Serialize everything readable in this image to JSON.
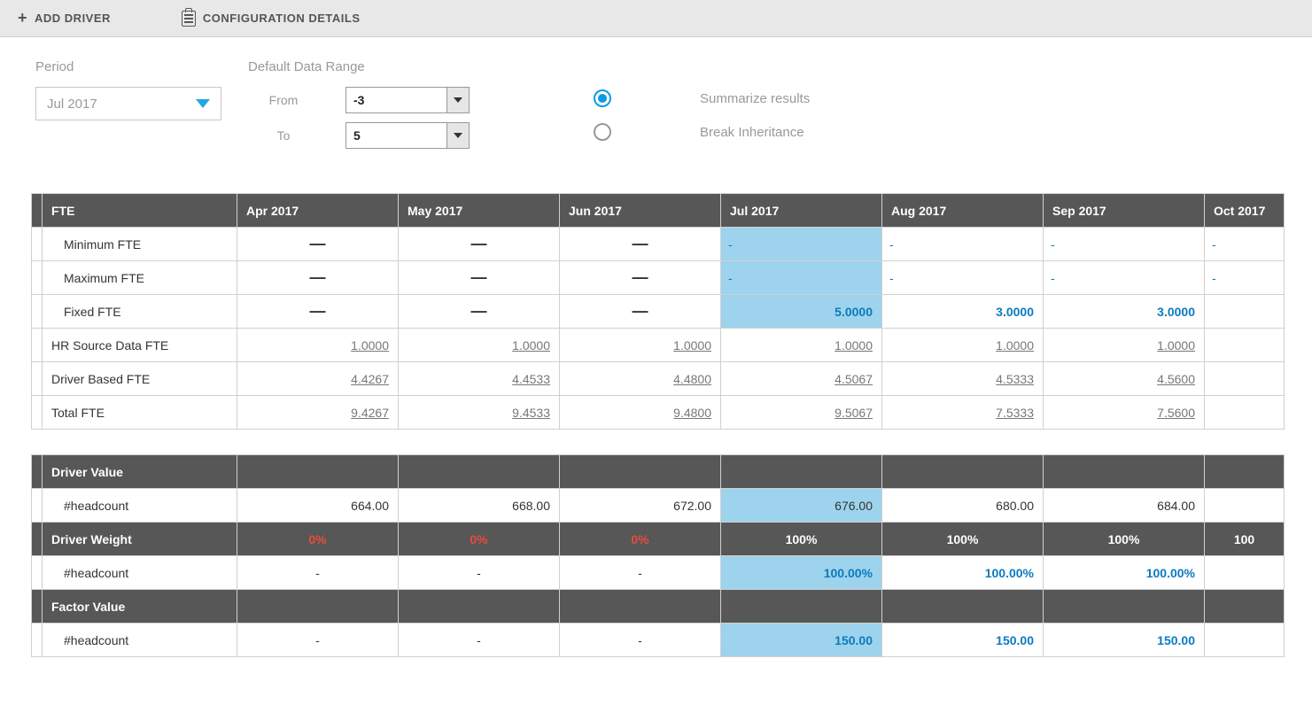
{
  "toolbar": {
    "add_driver": "ADD DRIVER",
    "config_details": "CONFIGURATION DETAILS"
  },
  "controls": {
    "period_label": "Period",
    "period_value": "Jul 2017",
    "range_label": "Default Data Range",
    "from_label": "From",
    "from_value": "-3",
    "to_label": "To",
    "to_value": "5",
    "radio_summarize": "Summarize results",
    "radio_break": "Break Inheritance"
  },
  "months": [
    "Apr 2017",
    "May 2017",
    "Jun 2017",
    "Jul 2017",
    "Aug 2017",
    "Sep 2017",
    "Oct 2017"
  ],
  "fte": {
    "title": "FTE",
    "rows": [
      {
        "label": "Minimum FTE",
        "indent": true,
        "cells": [
          {
            "t": "—",
            "cls": "dash"
          },
          {
            "t": "—",
            "cls": "dash"
          },
          {
            "t": "—",
            "cls": "dash"
          },
          {
            "t": "-",
            "cls": "hl hl-blue-dash"
          },
          {
            "t": "-",
            "cls": "future-dash"
          },
          {
            "t": "-",
            "cls": "future-dash"
          },
          {
            "t": "-",
            "cls": "future-dash"
          }
        ]
      },
      {
        "label": "Maximum FTE",
        "indent": true,
        "cells": [
          {
            "t": "—",
            "cls": "dash"
          },
          {
            "t": "—",
            "cls": "dash"
          },
          {
            "t": "—",
            "cls": "dash"
          },
          {
            "t": "-",
            "cls": "hl hl-blue-dash"
          },
          {
            "t": "-",
            "cls": "future-dash"
          },
          {
            "t": "-",
            "cls": "future-dash"
          },
          {
            "t": "-",
            "cls": "future-dash"
          }
        ]
      },
      {
        "label": "Fixed FTE",
        "indent": true,
        "cells": [
          {
            "t": "—",
            "cls": "dash"
          },
          {
            "t": "—",
            "cls": "dash"
          },
          {
            "t": "—",
            "cls": "dash"
          },
          {
            "t": "5.0000",
            "cls": "hl val blue-bold"
          },
          {
            "t": "3.0000",
            "cls": "val blue-bold"
          },
          {
            "t": "3.0000",
            "cls": "val blue-bold"
          },
          {
            "t": "",
            "cls": "val"
          }
        ]
      },
      {
        "label": "HR Source Data FTE",
        "indent": false,
        "cells": [
          {
            "t": "1.0000",
            "cls": "val underline"
          },
          {
            "t": "1.0000",
            "cls": "val underline"
          },
          {
            "t": "1.0000",
            "cls": "val underline"
          },
          {
            "t": "1.0000",
            "cls": "val underline"
          },
          {
            "t": "1.0000",
            "cls": "val underline"
          },
          {
            "t": "1.0000",
            "cls": "val underline"
          },
          {
            "t": "",
            "cls": "val"
          }
        ]
      },
      {
        "label": "Driver Based FTE",
        "indent": false,
        "cells": [
          {
            "t": "4.4267",
            "cls": "val underline"
          },
          {
            "t": "4.4533",
            "cls": "val underline"
          },
          {
            "t": "4.4800",
            "cls": "val underline"
          },
          {
            "t": "4.5067",
            "cls": "val underline"
          },
          {
            "t": "4.5333",
            "cls": "val underline"
          },
          {
            "t": "4.5600",
            "cls": "val underline"
          },
          {
            "t": "",
            "cls": "val"
          }
        ]
      },
      {
        "label": "Total FTE",
        "indent": false,
        "cells": [
          {
            "t": "9.4267",
            "cls": "val underline"
          },
          {
            "t": "9.4533",
            "cls": "val underline"
          },
          {
            "t": "9.4800",
            "cls": "val underline"
          },
          {
            "t": "9.5067",
            "cls": "val underline"
          },
          {
            "t": "7.5333",
            "cls": "val underline"
          },
          {
            "t": "7.5600",
            "cls": "val underline"
          },
          {
            "t": "",
            "cls": "val"
          }
        ]
      }
    ]
  },
  "drivers": {
    "sections": [
      {
        "title": "Driver Value",
        "header_vals": [
          "",
          "",
          "",
          "",
          "",
          "",
          ""
        ],
        "rows": [
          {
            "label": "#headcount",
            "indent": true,
            "cells": [
              {
                "t": "664.00",
                "cls": "val"
              },
              {
                "t": "668.00",
                "cls": "val"
              },
              {
                "t": "672.00",
                "cls": "val"
              },
              {
                "t": "676.00",
                "cls": "hl val"
              },
              {
                "t": "680.00",
                "cls": "val"
              },
              {
                "t": "684.00",
                "cls": "val"
              },
              {
                "t": "",
                "cls": "val"
              }
            ]
          }
        ]
      },
      {
        "title": "Driver Weight",
        "header_vals": [
          "0%",
          "0%",
          "0%",
          "100%",
          "100%",
          "100%",
          "100"
        ],
        "header_cls": [
          "red-bold",
          "red-bold",
          "red-bold",
          "",
          "",
          "",
          ""
        ],
        "rows": [
          {
            "label": "#headcount",
            "indent": true,
            "cells": [
              {
                "t": "-",
                "cls": "dash-small"
              },
              {
                "t": "-",
                "cls": "dash-small"
              },
              {
                "t": "-",
                "cls": "dash-small"
              },
              {
                "t": "100.00%",
                "cls": "hl val blue-bold"
              },
              {
                "t": "100.00%",
                "cls": "val blue-bold"
              },
              {
                "t": "100.00%",
                "cls": "val blue-bold"
              },
              {
                "t": "",
                "cls": "val"
              }
            ]
          }
        ]
      },
      {
        "title": "Factor Value",
        "header_vals": [
          "",
          "",
          "",
          "",
          "",
          "",
          ""
        ],
        "rows": [
          {
            "label": "#headcount",
            "indent": true,
            "cells": [
              {
                "t": "-",
                "cls": "dash-small"
              },
              {
                "t": "-",
                "cls": "dash-small"
              },
              {
                "t": "-",
                "cls": "dash-small"
              },
              {
                "t": "150.00",
                "cls": "hl val blue-bold"
              },
              {
                "t": "150.00",
                "cls": "val blue-bold"
              },
              {
                "t": "150.00",
                "cls": "val blue-bold"
              },
              {
                "t": "",
                "cls": "val"
              }
            ]
          }
        ]
      }
    ]
  }
}
